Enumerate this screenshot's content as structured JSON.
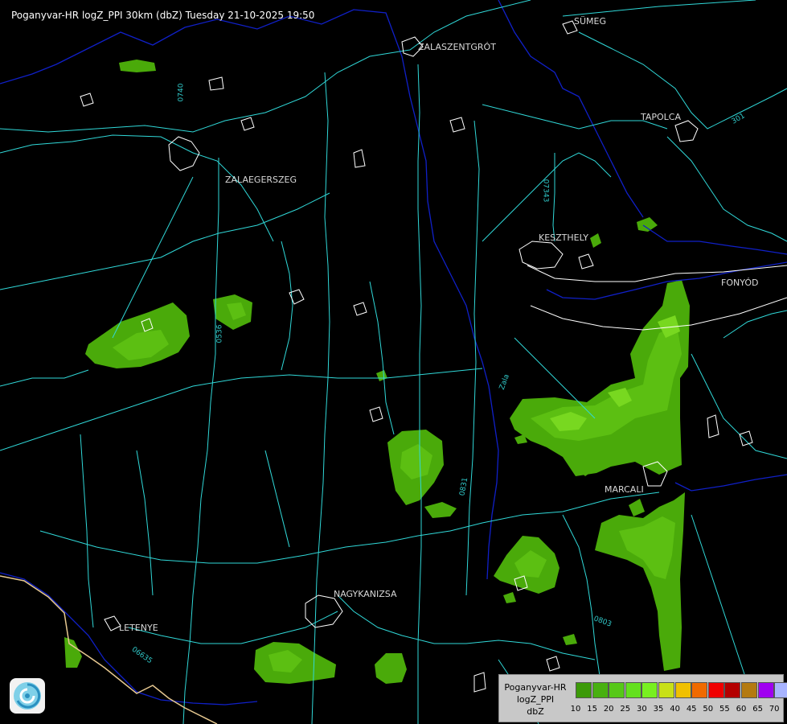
{
  "header": {
    "title": "Poganyvar-HR logZ_PPI 30km (dbZ) Tuesday 21-10-2025 19:50"
  },
  "map": {
    "background_color": "#000000",
    "road_color": "#30d8d8",
    "border_color": "#ffffff",
    "river_color": "#1020c8",
    "echo_colors": {
      "light": "#4aaa0a",
      "mid": "#5cbf12",
      "strong": "#78d820"
    },
    "cities": [
      {
        "id": "sumeg",
        "label": "SÜMEG"
      },
      {
        "id": "zalaszentgrot",
        "label": "ZALASZENTGRÓT"
      },
      {
        "id": "tapolca",
        "label": "TAPOLCA"
      },
      {
        "id": "zalaegerszeg",
        "label": "ZALAEGERSZEG"
      },
      {
        "id": "keszthely",
        "label": "KESZTHELY"
      },
      {
        "id": "fonyod",
        "label": "FONYÓD"
      },
      {
        "id": "marcali",
        "label": "MARCALI"
      },
      {
        "id": "nagykanizsa",
        "label": "NAGYKANIZSA"
      },
      {
        "id": "letenye",
        "label": "LETENYE"
      }
    ],
    "road_labels": [
      {
        "id": "r0740",
        "label": "0740"
      },
      {
        "id": "r07343",
        "label": "07343"
      },
      {
        "id": "r0536",
        "label": "0536"
      },
      {
        "id": "r0831",
        "label": "0831"
      },
      {
        "id": "r0803",
        "label": "0803"
      },
      {
        "id": "r06635",
        "label": "06635"
      },
      {
        "id": "r301",
        "label": "301"
      }
    ],
    "river_labels": [
      {
        "id": "zala",
        "label": "Zala"
      }
    ]
  },
  "legend": {
    "name_lines": [
      "Poganyvar-HR",
      "logZ_PPI",
      "dbZ"
    ],
    "bins": [
      {
        "value": "10",
        "color": "#3c9a08"
      },
      {
        "value": "15",
        "color": "#48b010"
      },
      {
        "value": "20",
        "color": "#56c818"
      },
      {
        "value": "25",
        "color": "#64e01e"
      },
      {
        "value": "30",
        "color": "#78f020"
      },
      {
        "value": "35",
        "color": "#c8e018"
      },
      {
        "value": "40",
        "color": "#f0c000"
      },
      {
        "value": "45",
        "color": "#f06a00"
      },
      {
        "value": "50",
        "color": "#f00000"
      },
      {
        "value": "55",
        "color": "#b40000"
      },
      {
        "value": "60",
        "color": "#b47a10"
      },
      {
        "value": "65",
        "color": "#a000f0"
      },
      {
        "value": "70",
        "color": "#a8b4ff"
      }
    ]
  }
}
